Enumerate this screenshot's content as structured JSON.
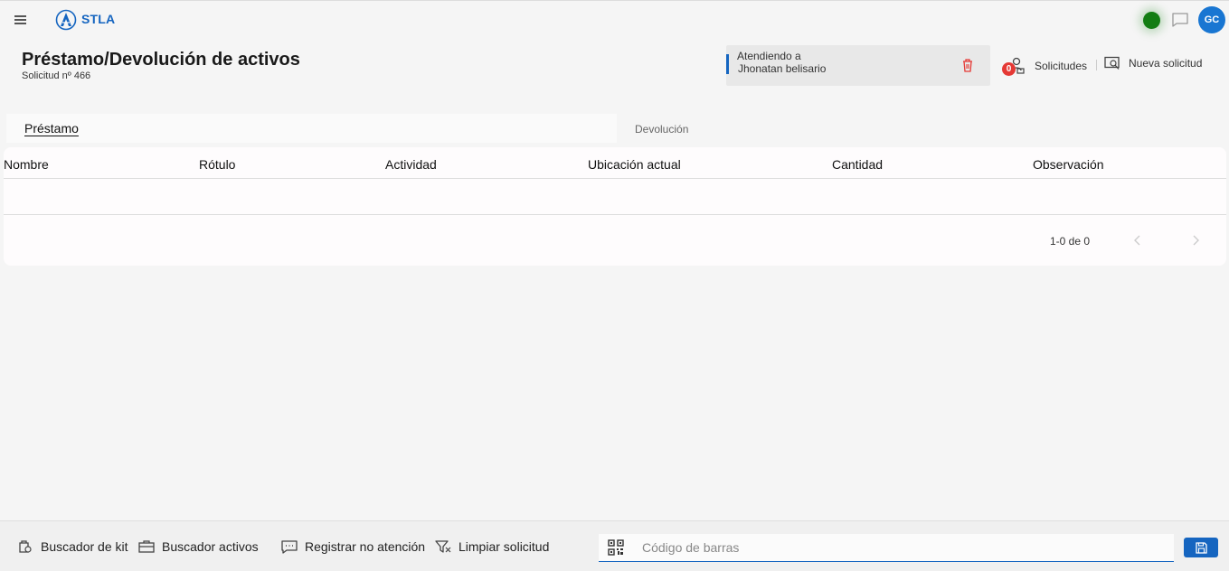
{
  "header": {
    "brand": "STLA",
    "avatar_initials": "GC",
    "status_color": "#137d13"
  },
  "page": {
    "title": "Préstamo/Devolución de activos",
    "subtitle": "Solicitud nº 466"
  },
  "attending": {
    "label": "Atendiendo a",
    "name": "Jhonatan belisario"
  },
  "actions": {
    "solicitudes_label": "Solicitudes",
    "solicitudes_count": "0",
    "nueva_solicitud_label": "Nueva solicitud"
  },
  "tabs": [
    {
      "label": "Préstamo",
      "active": true
    },
    {
      "label": "Devolución",
      "active": false
    }
  ],
  "table": {
    "columns": [
      "Nombre",
      "Rótulo",
      "Actividad",
      "Ubicación actual",
      "Cantidad",
      "Observación"
    ],
    "rows": [],
    "pagination": "1-0 de 0"
  },
  "bottom_bar": {
    "items": [
      "Buscador de kit",
      "Buscador activos",
      "Registrar no atención",
      "Limpiar solicitud"
    ],
    "barcode_placeholder": "Código de barras"
  },
  "colors": {
    "accent": "#1565c0",
    "badge": "#e53935",
    "delete": "#e53935"
  }
}
